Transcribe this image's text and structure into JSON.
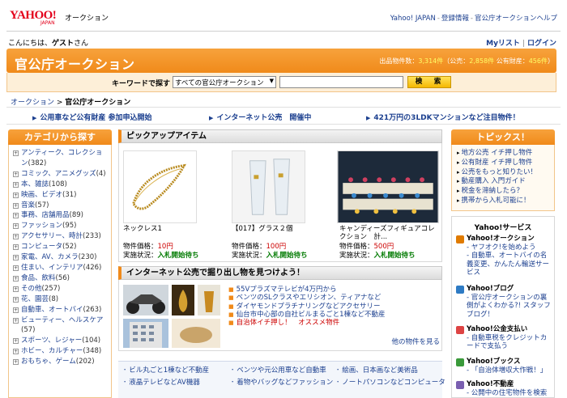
{
  "header": {
    "logo_text": "YAHOO!",
    "logo_sub": "JAPAN",
    "service_name": "オークション",
    "links": [
      "Yahoo! JAPAN",
      "登録情報",
      "官公庁オークションヘルプ"
    ]
  },
  "user": {
    "greeting_prefix": "こんにちは、",
    "name": "ゲスト",
    "greeting_suffix": "さん",
    "mylist": "Myリスト",
    "login": "ログイン"
  },
  "banner": {
    "title": "官公庁オークション",
    "stats_prefix": "出品物件数：",
    "stats_total": "3,314件",
    "stats_public_label": "（公売：",
    "stats_public": "2,858件",
    "stats_property_label": " 公有財産：",
    "stats_property": "456件",
    "stats_close": "）"
  },
  "search": {
    "label": "キーワードで探す",
    "select_value": "すべての官公庁オークション",
    "input_value": "",
    "button": "検　索"
  },
  "breadcrumb": {
    "root": "オークション",
    "sep": " > ",
    "current": "官公庁オークション"
  },
  "notices": [
    "公用車など公有財産 参加申込開始",
    "インターネット公売　開催中",
    "421万円の3LDKマンションなど注目物件！"
  ],
  "categories": {
    "heading": "カテゴリから探す",
    "items": [
      {
        "label": "アンティーク、コレクション",
        "count": "(382)"
      },
      {
        "label": "コミック、アニメグッズ",
        "count": "(4)"
      },
      {
        "label": "本、雑誌",
        "count": "(108)"
      },
      {
        "label": "映画、ビデオ",
        "count": "(31)"
      },
      {
        "label": "音楽",
        "count": "(57)"
      },
      {
        "label": "事務、店舗用品",
        "count": "(89)"
      },
      {
        "label": "ファッション",
        "count": "(95)"
      },
      {
        "label": "アクセサリー、時計",
        "count": "(233)"
      },
      {
        "label": "コンピュータ",
        "count": "(52)"
      },
      {
        "label": "家電、AV、カメラ",
        "count": "(230)"
      },
      {
        "label": "住まい、インテリア",
        "count": "(426)"
      },
      {
        "label": "食品、飲料",
        "count": "(56)"
      },
      {
        "label": "その他",
        "count": "(257)"
      },
      {
        "label": "花、園芸",
        "count": "(8)"
      },
      {
        "label": "自動車、オートバイ",
        "count": "(263)"
      },
      {
        "label": "ビューティー、ヘルスケア",
        "count": "(57)"
      },
      {
        "label": "スポーツ、レジャー",
        "count": "(104)"
      },
      {
        "label": "ホビー、カルチャー",
        "count": "(348)"
      },
      {
        "label": "おもちゃ、ゲーム",
        "count": "(202)"
      }
    ]
  },
  "pickup": {
    "heading": "ピックアップアイテム",
    "price_label": "物件価格：",
    "status_label": "実施状況：",
    "items": [
      {
        "title": "ネックレス1",
        "price": "10円",
        "status": "入札開始待ち"
      },
      {
        "title": "【017】グラス２個",
        "price": "100円",
        "status": "入札開始待ち"
      },
      {
        "title": "キャンディーズフィギュアコレクション　計...",
        "price": "500円",
        "status": "入札開始待ち"
      }
    ]
  },
  "internet": {
    "heading": "インターネット公売で掘り出し物を見つけよう！",
    "items": [
      "55Vプラズマテレビが4万円から",
      "ベンツのSLクラスやエリシオン、ティアナなど",
      "ダイヤモンドプラチナリングなどアクセサリー",
      "仙台市中心部の自社ビルまるごと1棟など不動産",
      "自治体イチ押し！　オススメ物件"
    ],
    "more": "他の物件を見る"
  },
  "bottom_links": [
    [
      "ビル丸ごと1棟など不動産",
      "ベンツや元公用車など自動車",
      "絵画、日本画など美術品"
    ],
    [
      "液晶テレビなどAV機器",
      "着物やバッグなどファッション",
      "ノートパソコンなどコンピュータ"
    ]
  ],
  "topics": {
    "heading": "トピックス！",
    "items": [
      "地方公売 イチ押し物件",
      "公有財産 イチ押し物件",
      "公売をもっと知りたい！",
      "動産購入 入門ガイド",
      "税金を滞納したら？",
      "携帯から入札可能に！"
    ]
  },
  "services": {
    "heading": "Yahoo!サービス",
    "items": [
      {
        "title": "Yahoo!オークション",
        "body": "- ヤフオク!を始めよう\n- 自動車、オートバイの名義変更、かんたん輸送サービス",
        "color": "#e07b00"
      },
      {
        "title": "Yahoo!ブログ",
        "body": "- 官公庁オークションの裏側がよくわかる?! スタッフブログ！",
        "color": "#2e7bc4"
      },
      {
        "title": "Yahoo!公金支払い",
        "body": "- 自動車税をクレジットカードで支払う",
        "color": "#d44"
      },
      {
        "title": "Yahoo!ブックス",
        "body": "- 「自治体増収大作戦！」",
        "color": "#3a9a3a"
      },
      {
        "title": "Yahoo!不動産",
        "body": "- 公開中の住宅物件を検索",
        "color": "#7a5fb0"
      }
    ]
  }
}
